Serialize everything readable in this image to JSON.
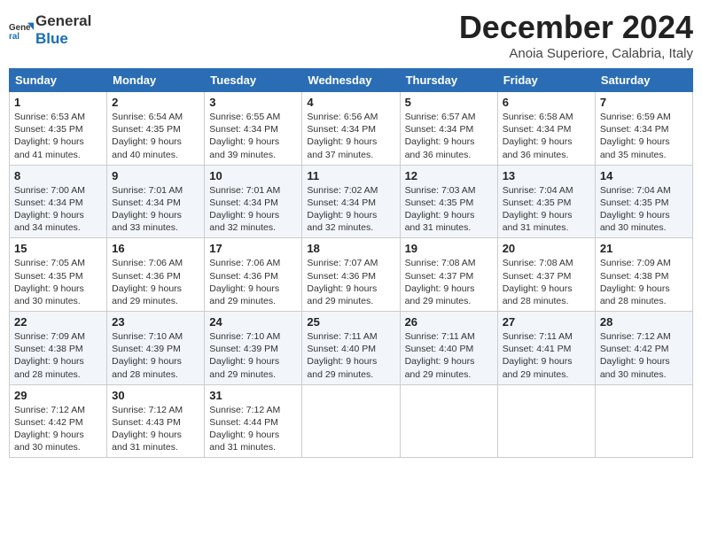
{
  "header": {
    "logo_line1": "General",
    "logo_line2": "Blue",
    "month_title": "December 2024",
    "subtitle": "Anoia Superiore, Calabria, Italy"
  },
  "weekdays": [
    "Sunday",
    "Monday",
    "Tuesday",
    "Wednesday",
    "Thursday",
    "Friday",
    "Saturday"
  ],
  "weeks": [
    [
      {
        "day": "1",
        "sunrise": "6:53 AM",
        "sunset": "4:35 PM",
        "daylight": "9 hours and 41 minutes."
      },
      {
        "day": "2",
        "sunrise": "6:54 AM",
        "sunset": "4:35 PM",
        "daylight": "9 hours and 40 minutes."
      },
      {
        "day": "3",
        "sunrise": "6:55 AM",
        "sunset": "4:34 PM",
        "daylight": "9 hours and 39 minutes."
      },
      {
        "day": "4",
        "sunrise": "6:56 AM",
        "sunset": "4:34 PM",
        "daylight": "9 hours and 37 minutes."
      },
      {
        "day": "5",
        "sunrise": "6:57 AM",
        "sunset": "4:34 PM",
        "daylight": "9 hours and 36 minutes."
      },
      {
        "day": "6",
        "sunrise": "6:58 AM",
        "sunset": "4:34 PM",
        "daylight": "9 hours and 36 minutes."
      },
      {
        "day": "7",
        "sunrise": "6:59 AM",
        "sunset": "4:34 PM",
        "daylight": "9 hours and 35 minutes."
      }
    ],
    [
      {
        "day": "8",
        "sunrise": "7:00 AM",
        "sunset": "4:34 PM",
        "daylight": "9 hours and 34 minutes."
      },
      {
        "day": "9",
        "sunrise": "7:01 AM",
        "sunset": "4:34 PM",
        "daylight": "9 hours and 33 minutes."
      },
      {
        "day": "10",
        "sunrise": "7:01 AM",
        "sunset": "4:34 PM",
        "daylight": "9 hours and 32 minutes."
      },
      {
        "day": "11",
        "sunrise": "7:02 AM",
        "sunset": "4:34 PM",
        "daylight": "9 hours and 32 minutes."
      },
      {
        "day": "12",
        "sunrise": "7:03 AM",
        "sunset": "4:35 PM",
        "daylight": "9 hours and 31 minutes."
      },
      {
        "day": "13",
        "sunrise": "7:04 AM",
        "sunset": "4:35 PM",
        "daylight": "9 hours and 31 minutes."
      },
      {
        "day": "14",
        "sunrise": "7:04 AM",
        "sunset": "4:35 PM",
        "daylight": "9 hours and 30 minutes."
      }
    ],
    [
      {
        "day": "15",
        "sunrise": "7:05 AM",
        "sunset": "4:35 PM",
        "daylight": "9 hours and 30 minutes."
      },
      {
        "day": "16",
        "sunrise": "7:06 AM",
        "sunset": "4:36 PM",
        "daylight": "9 hours and 29 minutes."
      },
      {
        "day": "17",
        "sunrise": "7:06 AM",
        "sunset": "4:36 PM",
        "daylight": "9 hours and 29 minutes."
      },
      {
        "day": "18",
        "sunrise": "7:07 AM",
        "sunset": "4:36 PM",
        "daylight": "9 hours and 29 minutes."
      },
      {
        "day": "19",
        "sunrise": "7:08 AM",
        "sunset": "4:37 PM",
        "daylight": "9 hours and 29 minutes."
      },
      {
        "day": "20",
        "sunrise": "7:08 AM",
        "sunset": "4:37 PM",
        "daylight": "9 hours and 28 minutes."
      },
      {
        "day": "21",
        "sunrise": "7:09 AM",
        "sunset": "4:38 PM",
        "daylight": "9 hours and 28 minutes."
      }
    ],
    [
      {
        "day": "22",
        "sunrise": "7:09 AM",
        "sunset": "4:38 PM",
        "daylight": "9 hours and 28 minutes."
      },
      {
        "day": "23",
        "sunrise": "7:10 AM",
        "sunset": "4:39 PM",
        "daylight": "9 hours and 28 minutes."
      },
      {
        "day": "24",
        "sunrise": "7:10 AM",
        "sunset": "4:39 PM",
        "daylight": "9 hours and 29 minutes."
      },
      {
        "day": "25",
        "sunrise": "7:11 AM",
        "sunset": "4:40 PM",
        "daylight": "9 hours and 29 minutes."
      },
      {
        "day": "26",
        "sunrise": "7:11 AM",
        "sunset": "4:40 PM",
        "daylight": "9 hours and 29 minutes."
      },
      {
        "day": "27",
        "sunrise": "7:11 AM",
        "sunset": "4:41 PM",
        "daylight": "9 hours and 29 minutes."
      },
      {
        "day": "28",
        "sunrise": "7:12 AM",
        "sunset": "4:42 PM",
        "daylight": "9 hours and 30 minutes."
      }
    ],
    [
      {
        "day": "29",
        "sunrise": "7:12 AM",
        "sunset": "4:42 PM",
        "daylight": "9 hours and 30 minutes."
      },
      {
        "day": "30",
        "sunrise": "7:12 AM",
        "sunset": "4:43 PM",
        "daylight": "9 hours and 31 minutes."
      },
      {
        "day": "31",
        "sunrise": "7:12 AM",
        "sunset": "4:44 PM",
        "daylight": "9 hours and 31 minutes."
      },
      null,
      null,
      null,
      null
    ]
  ],
  "labels": {
    "sunrise_prefix": "Sunrise: ",
    "sunset_prefix": "Sunset: ",
    "daylight_prefix": "Daylight: "
  }
}
